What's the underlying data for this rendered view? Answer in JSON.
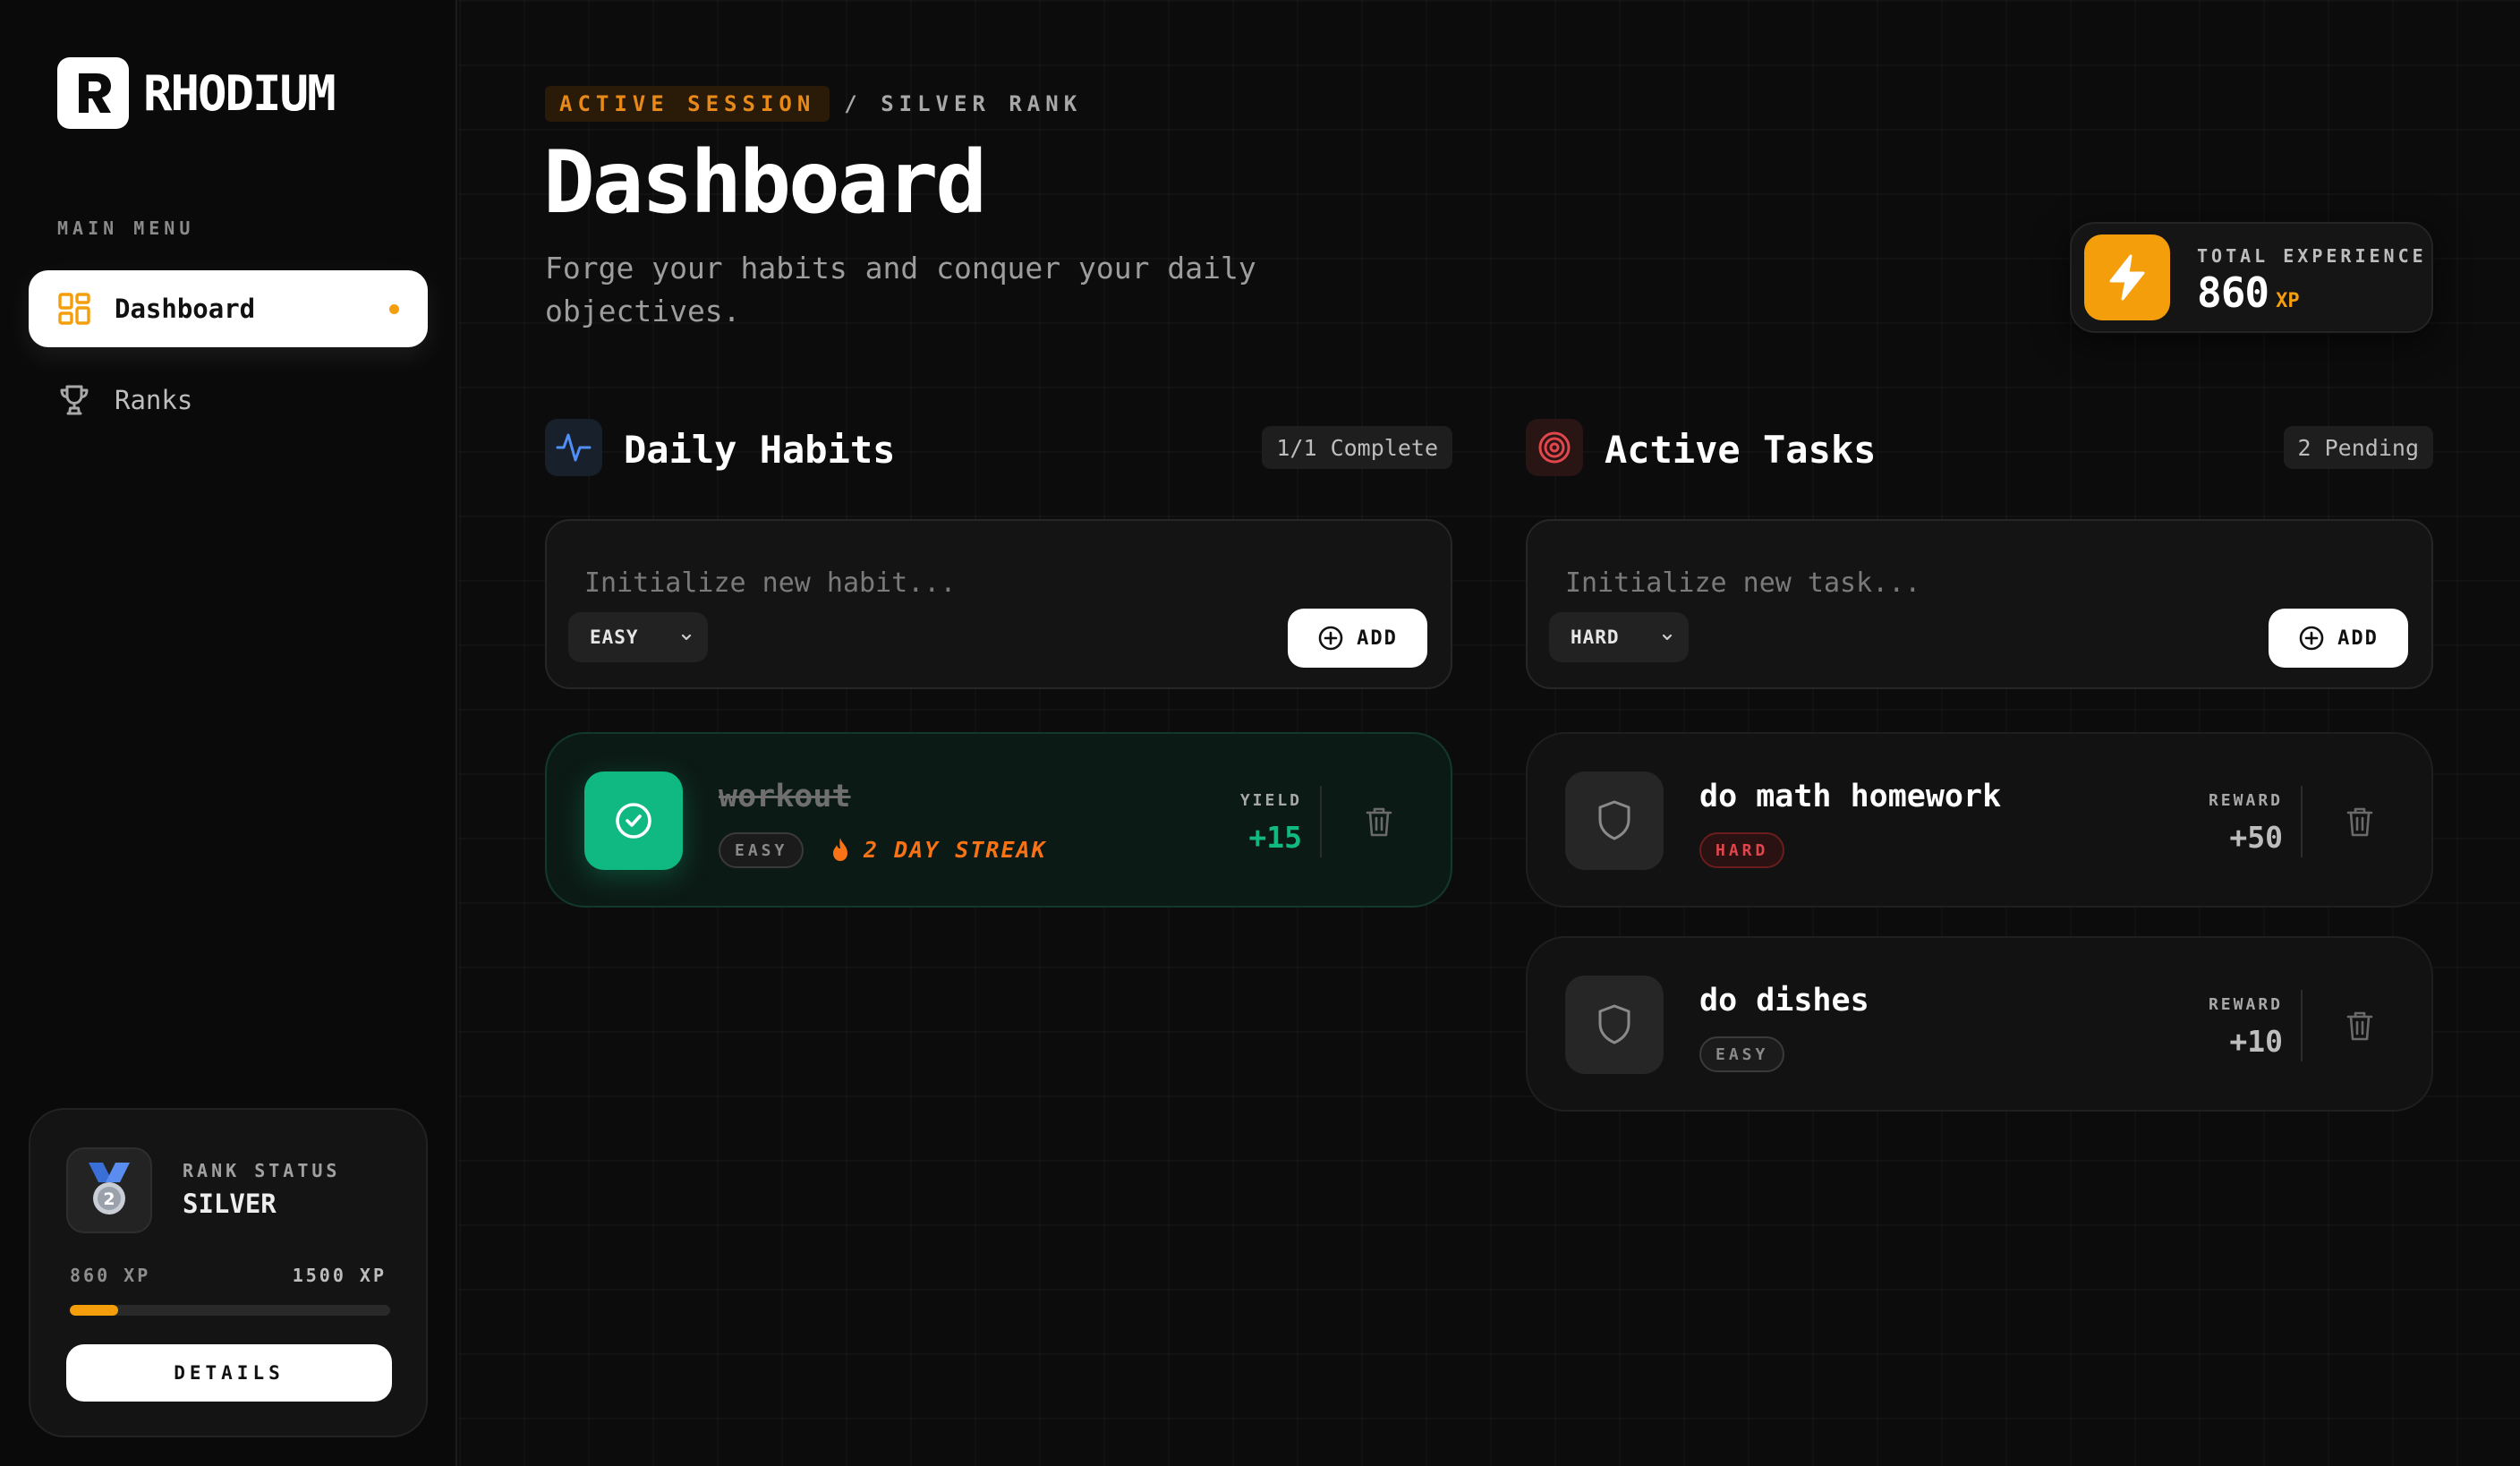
{
  "app": {
    "name": "RHODIUM",
    "logo_letter": "R"
  },
  "sidebar": {
    "menu_title": "MAIN MENU",
    "items": [
      {
        "label": "Dashboard",
        "icon": "dashboard-grid-icon",
        "active": true
      },
      {
        "label": "Ranks",
        "icon": "trophy-icon",
        "active": false
      }
    ],
    "rank_card": {
      "label": "RANK STATUS",
      "rank": "SILVER",
      "medal_number": "2",
      "xp_current": "860 XP",
      "xp_target": "1500 XP",
      "progress": 0.15,
      "details_label": "DETAILS"
    }
  },
  "header": {
    "badge": "ACTIVE SESSION",
    "crumb": "/ SILVER RANK",
    "title": "Dashboard",
    "subtitle": "Forge your habits and conquer your daily objectives."
  },
  "xp_card": {
    "label": "TOTAL EXPERIENCE",
    "value": "860",
    "unit": "XP"
  },
  "habits": {
    "title": "Daily Habits",
    "badge": "1/1 Complete",
    "input_placeholder": "Initialize new habit...",
    "difficulty": "EASY",
    "add_label": "ADD",
    "items": [
      {
        "name": "workout",
        "difficulty": "EASY",
        "streak": "2 DAY STREAK",
        "yield_label": "YIELD",
        "yield": "+15",
        "completed": true
      }
    ]
  },
  "tasks": {
    "title": "Active Tasks",
    "badge": "2 Pending",
    "input_placeholder": "Initialize new task...",
    "difficulty": "HARD",
    "add_label": "ADD",
    "items": [
      {
        "name": "do math homework",
        "difficulty": "HARD",
        "reward_label": "REWARD",
        "reward": "+50"
      },
      {
        "name": "do dishes",
        "difficulty": "EASY",
        "reward_label": "REWARD",
        "reward": "+10"
      }
    ]
  },
  "colors": {
    "accent": "#f59e0b",
    "success": "#10b981",
    "danger": "#e0464c",
    "background": "#0b0b0b"
  }
}
